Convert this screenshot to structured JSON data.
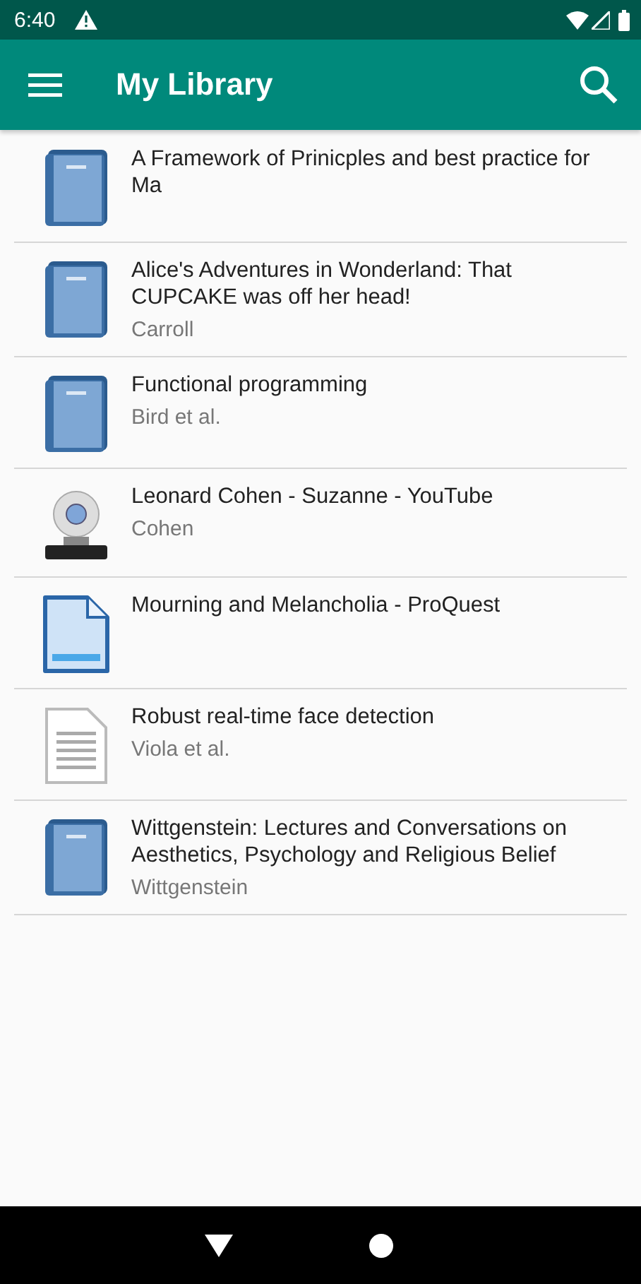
{
  "status_bar": {
    "time": "6:40"
  },
  "app_bar": {
    "title": "My Library"
  },
  "items": [
    {
      "kind": "book",
      "title": "A Framework of Prinicples and best practice for Ma"
    },
    {
      "kind": "book",
      "title": "Alice's Adventures in Wonderland: That CUPCAKE was off her head!",
      "author": "Carroll"
    },
    {
      "kind": "book",
      "title": "Functional programming",
      "author": "Bird et al."
    },
    {
      "kind": "video",
      "title": "Leonard Cohen - Suzanne - YouTube",
      "author": "Cohen"
    },
    {
      "kind": "webpage",
      "title": "Mourning and Melancholia - ProQuest"
    },
    {
      "kind": "document",
      "title": "Robust real-time face detection",
      "author": "Viola et al."
    },
    {
      "kind": "book",
      "title": "Wittgenstein: Lectures and Conversations on Aesthetics, Psychology and Religious Belief",
      "author": "Wittgenstein"
    }
  ]
}
